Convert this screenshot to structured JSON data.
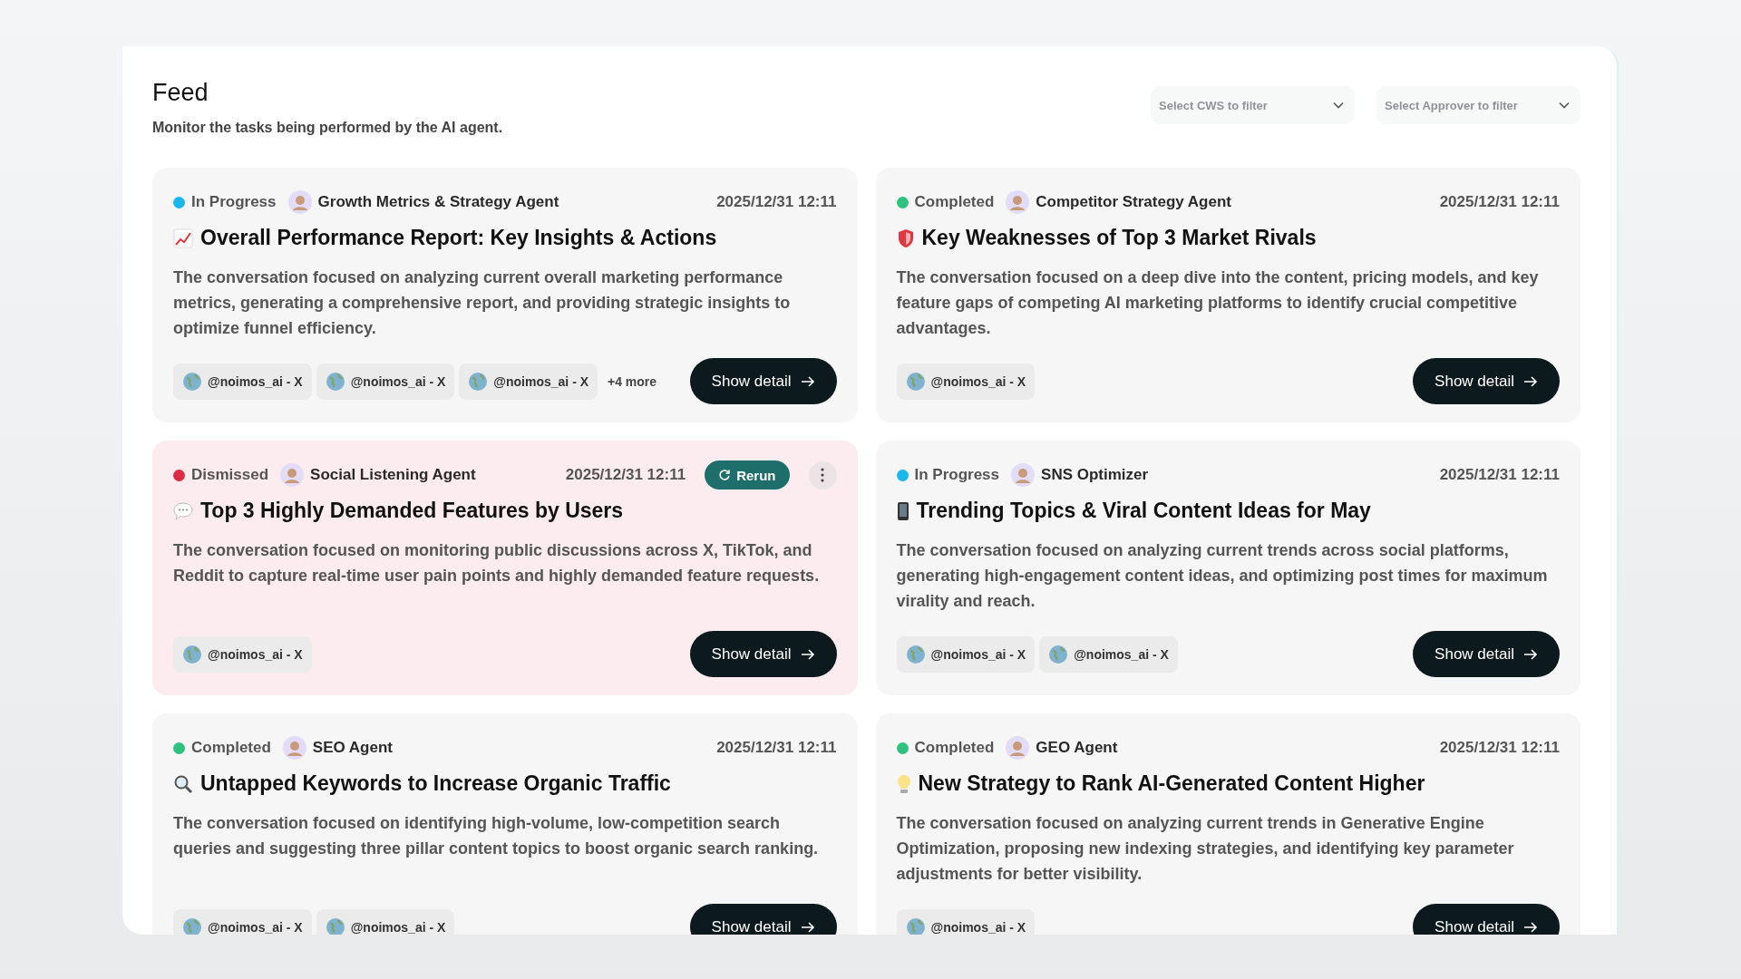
{
  "header": {
    "title": "Feed",
    "subtitle": "Monitor the tasks being performed by the AI agent."
  },
  "filters": [
    {
      "placeholder": "Select CWS to filter"
    },
    {
      "placeholder": "Select Approver to filter"
    }
  ],
  "cards": [
    {
      "status": "In Progress",
      "color": "#1ab8ea",
      "agent": "Growth Metrics & Strategy Agent",
      "time": "2025/12/31 12:11",
      "dismissed": false,
      "title": "Overall Performance Report: Key Insights & Actions",
      "description": "The conversation focused on analyzing current overall marketing performance metrics, generating a comprehensive report, and providing strategic insights to optimize funnel efficiency.",
      "tags": [
        "@noimos_ai - X",
        "@noimos_ai - X",
        "@noimos_ai - X"
      ],
      "more": "+4 more",
      "button": "Show detail"
    },
    {
      "status": "Completed",
      "color": "#2ec27e",
      "agent": "Competitor Strategy Agent",
      "time": "2025/12/31 12:11",
      "dismissed": false,
      "title": "Key Weaknesses of Top 3 Market Rivals",
      "description": "The conversation focused on a deep dive into the content, pricing models, and key feature gaps of competing AI marketing platforms to identify crucial competitive advantages.",
      "tags": [
        "@noimos_ai - X"
      ],
      "button": "Show detail"
    },
    {
      "status": "Dismissed",
      "color": "#d92b45",
      "agent": "Social Listening Agent",
      "time": "2025/12/31 12:11",
      "dismissed": true,
      "rerun": "Rerun",
      "title": "Top 3 Highly Demanded Features by Users",
      "description": "The conversation focused on monitoring public discussions across X, TikTok, and Reddit to capture real-time user pain points and highly demanded feature requests.",
      "tags": [
        "@noimos_ai - X"
      ],
      "button": "Show detail"
    },
    {
      "status": "In Progress",
      "color": "#1ab8ea",
      "agent": "SNS Optimizer",
      "time": "2025/12/31 12:11",
      "dismissed": false,
      "title": "Trending Topics & Viral Content Ideas for May",
      "description": "The conversation focused on analyzing current trends across social platforms, generating high-engagement content ideas, and optimizing post times for maximum virality and reach.",
      "tags": [
        "@noimos_ai - X",
        "@noimos_ai - X"
      ],
      "button": "Show detail"
    },
    {
      "status": "Completed",
      "color": "#2ec27e",
      "agent": "SEO Agent",
      "time": "2025/12/31 12:11",
      "dismissed": false,
      "title": "Untapped Keywords to Increase Organic Traffic",
      "description": "The conversation focused on identifying high-volume, low-competition search queries and suggesting three pillar content topics to boost organic search ranking.",
      "tags": [
        "@noimos_ai - X",
        "@noimos_ai - X"
      ],
      "button": "Show detail"
    },
    {
      "status": "Completed",
      "color": "#2ec27e",
      "agent": "GEO Agent",
      "time": "2025/12/31 12:11",
      "dismissed": false,
      "title": "New Strategy to Rank AI-Generated Content Higher",
      "description": "The conversation focused on analyzing current trends in Generative Engine Optimization, proposing new indexing strategies, and identifying key parameter adjustments for better visibility.",
      "tags": [
        "@noimos_ai - X"
      ],
      "button": "Show detail"
    }
  ]
}
